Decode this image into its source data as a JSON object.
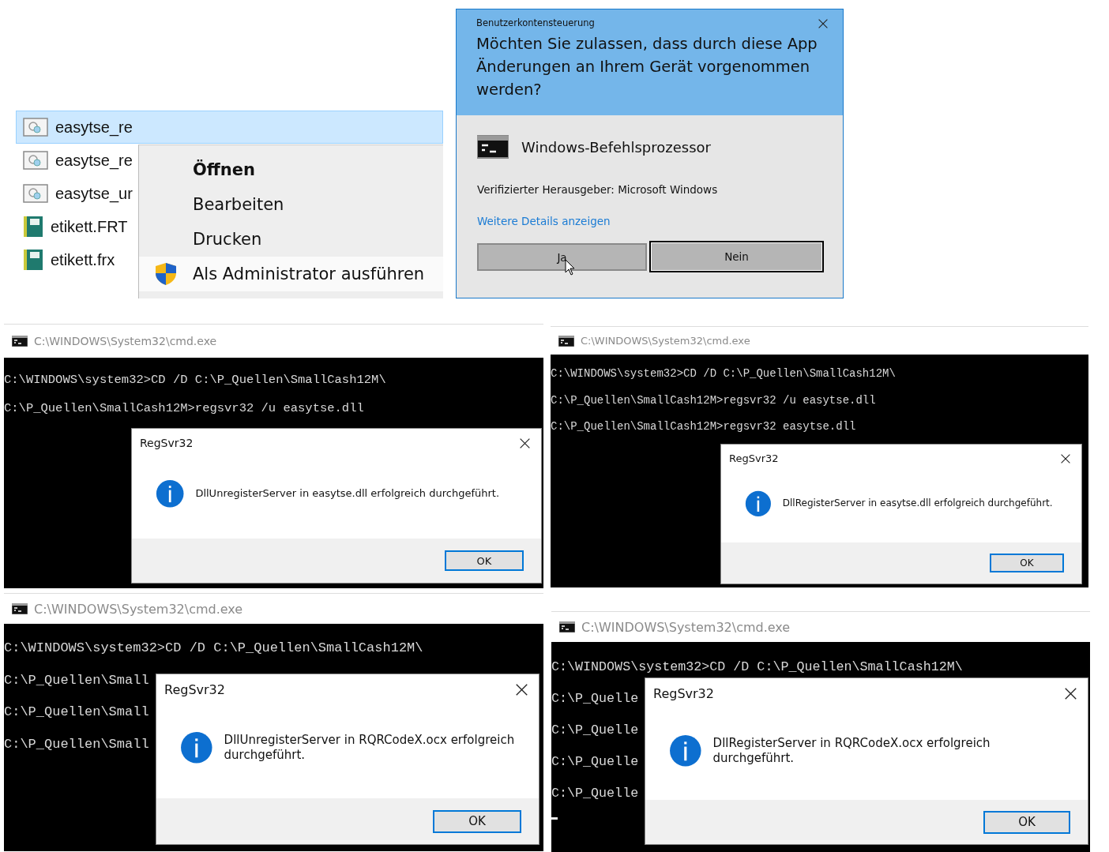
{
  "explorer": {
    "files": [
      {
        "name": "easytse_re",
        "kind": "config",
        "selected": true
      },
      {
        "name": "easytse_re",
        "kind": "config",
        "selected": false
      },
      {
        "name": "easytse_ur",
        "kind": "config",
        "selected": false
      },
      {
        "name": "etikett.FRT",
        "kind": "form",
        "selected": false
      },
      {
        "name": "etikett.frx",
        "kind": "form",
        "selected": false
      }
    ],
    "context_menu": [
      {
        "label": "Öffnen",
        "default": true,
        "highlighted": false,
        "shield": false
      },
      {
        "label": "Bearbeiten",
        "default": false,
        "highlighted": false,
        "shield": false
      },
      {
        "label": "Drucken",
        "default": false,
        "highlighted": false,
        "shield": false
      },
      {
        "label": "Als Administrator ausführen",
        "default": false,
        "highlighted": true,
        "shield": true
      }
    ]
  },
  "uac": {
    "title": "Benutzerkontensteuerung",
    "question": "Möchten Sie zulassen, dass durch diese App Änderungen an Ihrem Gerät vorgenommen werden?",
    "app_name": "Windows-Befehlsprozessor",
    "publisher": "Verifizierter Herausgeber: Microsoft Windows",
    "details_link": "Weitere Details anzeigen",
    "buttons": [
      {
        "label": "Ja",
        "focused": false
      },
      {
        "label": "Nein",
        "focused": true
      }
    ]
  },
  "consoles": [
    {
      "title": "C:\\WINDOWS\\System32\\cmd.exe",
      "lines": [
        "C:\\WINDOWS\\system32>CD /D C:\\P_Quellen\\SmallCash12M\\",
        "C:\\P_Quellen\\SmallCash12M>regsvr32 /u easytse.dll"
      ],
      "cursor": false,
      "dialog": {
        "title": "RegSvr32",
        "message": "DllUnregisterServer in easytse.dll erfolgreich durchgeführt.",
        "button": "OK"
      }
    },
    {
      "title": "C:\\WINDOWS\\System32\\cmd.exe",
      "lines": [
        "C:\\WINDOWS\\system32>CD /D C:\\P_Quellen\\SmallCash12M\\",
        "C:\\P_Quellen\\SmallCash12M>regsvr32 /u easytse.dll",
        "C:\\P_Quellen\\SmallCash12M>regsvr32 easytse.dll"
      ],
      "cursor": false,
      "dialog": {
        "title": "RegSvr32",
        "message": "DllRegisterServer in easytse.dll erfolgreich durchgeführt.",
        "button": "OK"
      }
    },
    {
      "title": "C:\\WINDOWS\\System32\\cmd.exe",
      "lines": [
        "C:\\WINDOWS\\system32>CD /D C:\\P_Quellen\\SmallCash12M\\",
        "C:\\P_Quellen\\Small",
        "C:\\P_Quellen\\Small",
        "C:\\P_Quellen\\Small"
      ],
      "cursor": false,
      "dialog": {
        "title": "RegSvr32",
        "message": "DllUnregisterServer in RQRCodeX.ocx erfolgreich durchgeführt.",
        "button": "OK"
      }
    },
    {
      "title": "C:\\WINDOWS\\System32\\cmd.exe",
      "lines": [
        "C:\\WINDOWS\\system32>CD /D C:\\P_Quellen\\SmallCash12M\\",
        "C:\\P_Quelle",
        "C:\\P_Quelle",
        "C:\\P_Quelle",
        "C:\\P_Quelle"
      ],
      "cursor": true,
      "dialog": {
        "title": "RegSvr32",
        "message": "DllRegisterServer in RQRCodeX.ocx erfolgreich durchgeführt.",
        "button": "OK"
      }
    }
  ]
}
